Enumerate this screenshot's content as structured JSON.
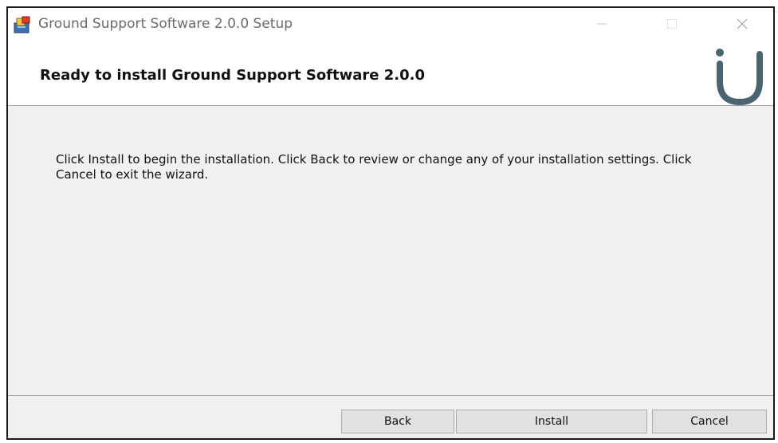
{
  "window": {
    "title": "Ground Support Software 2.0.0 Setup"
  },
  "header": {
    "title": "Ready to install Ground Support Software 2.0.0",
    "logo_icon": "u-logo-icon",
    "logo_color": "#4a6472"
  },
  "body": {
    "description": "Click Install to begin the installation. Click Back to review or change any of your installation settings. Click Cancel to exit the wizard."
  },
  "buttons": {
    "back": "Back",
    "install": "Install",
    "cancel": "Cancel"
  },
  "titlebar_controls": {
    "minimize_icon": "minimize-icon",
    "maximize_icon": "maximize-icon",
    "close_icon": "close-icon"
  }
}
